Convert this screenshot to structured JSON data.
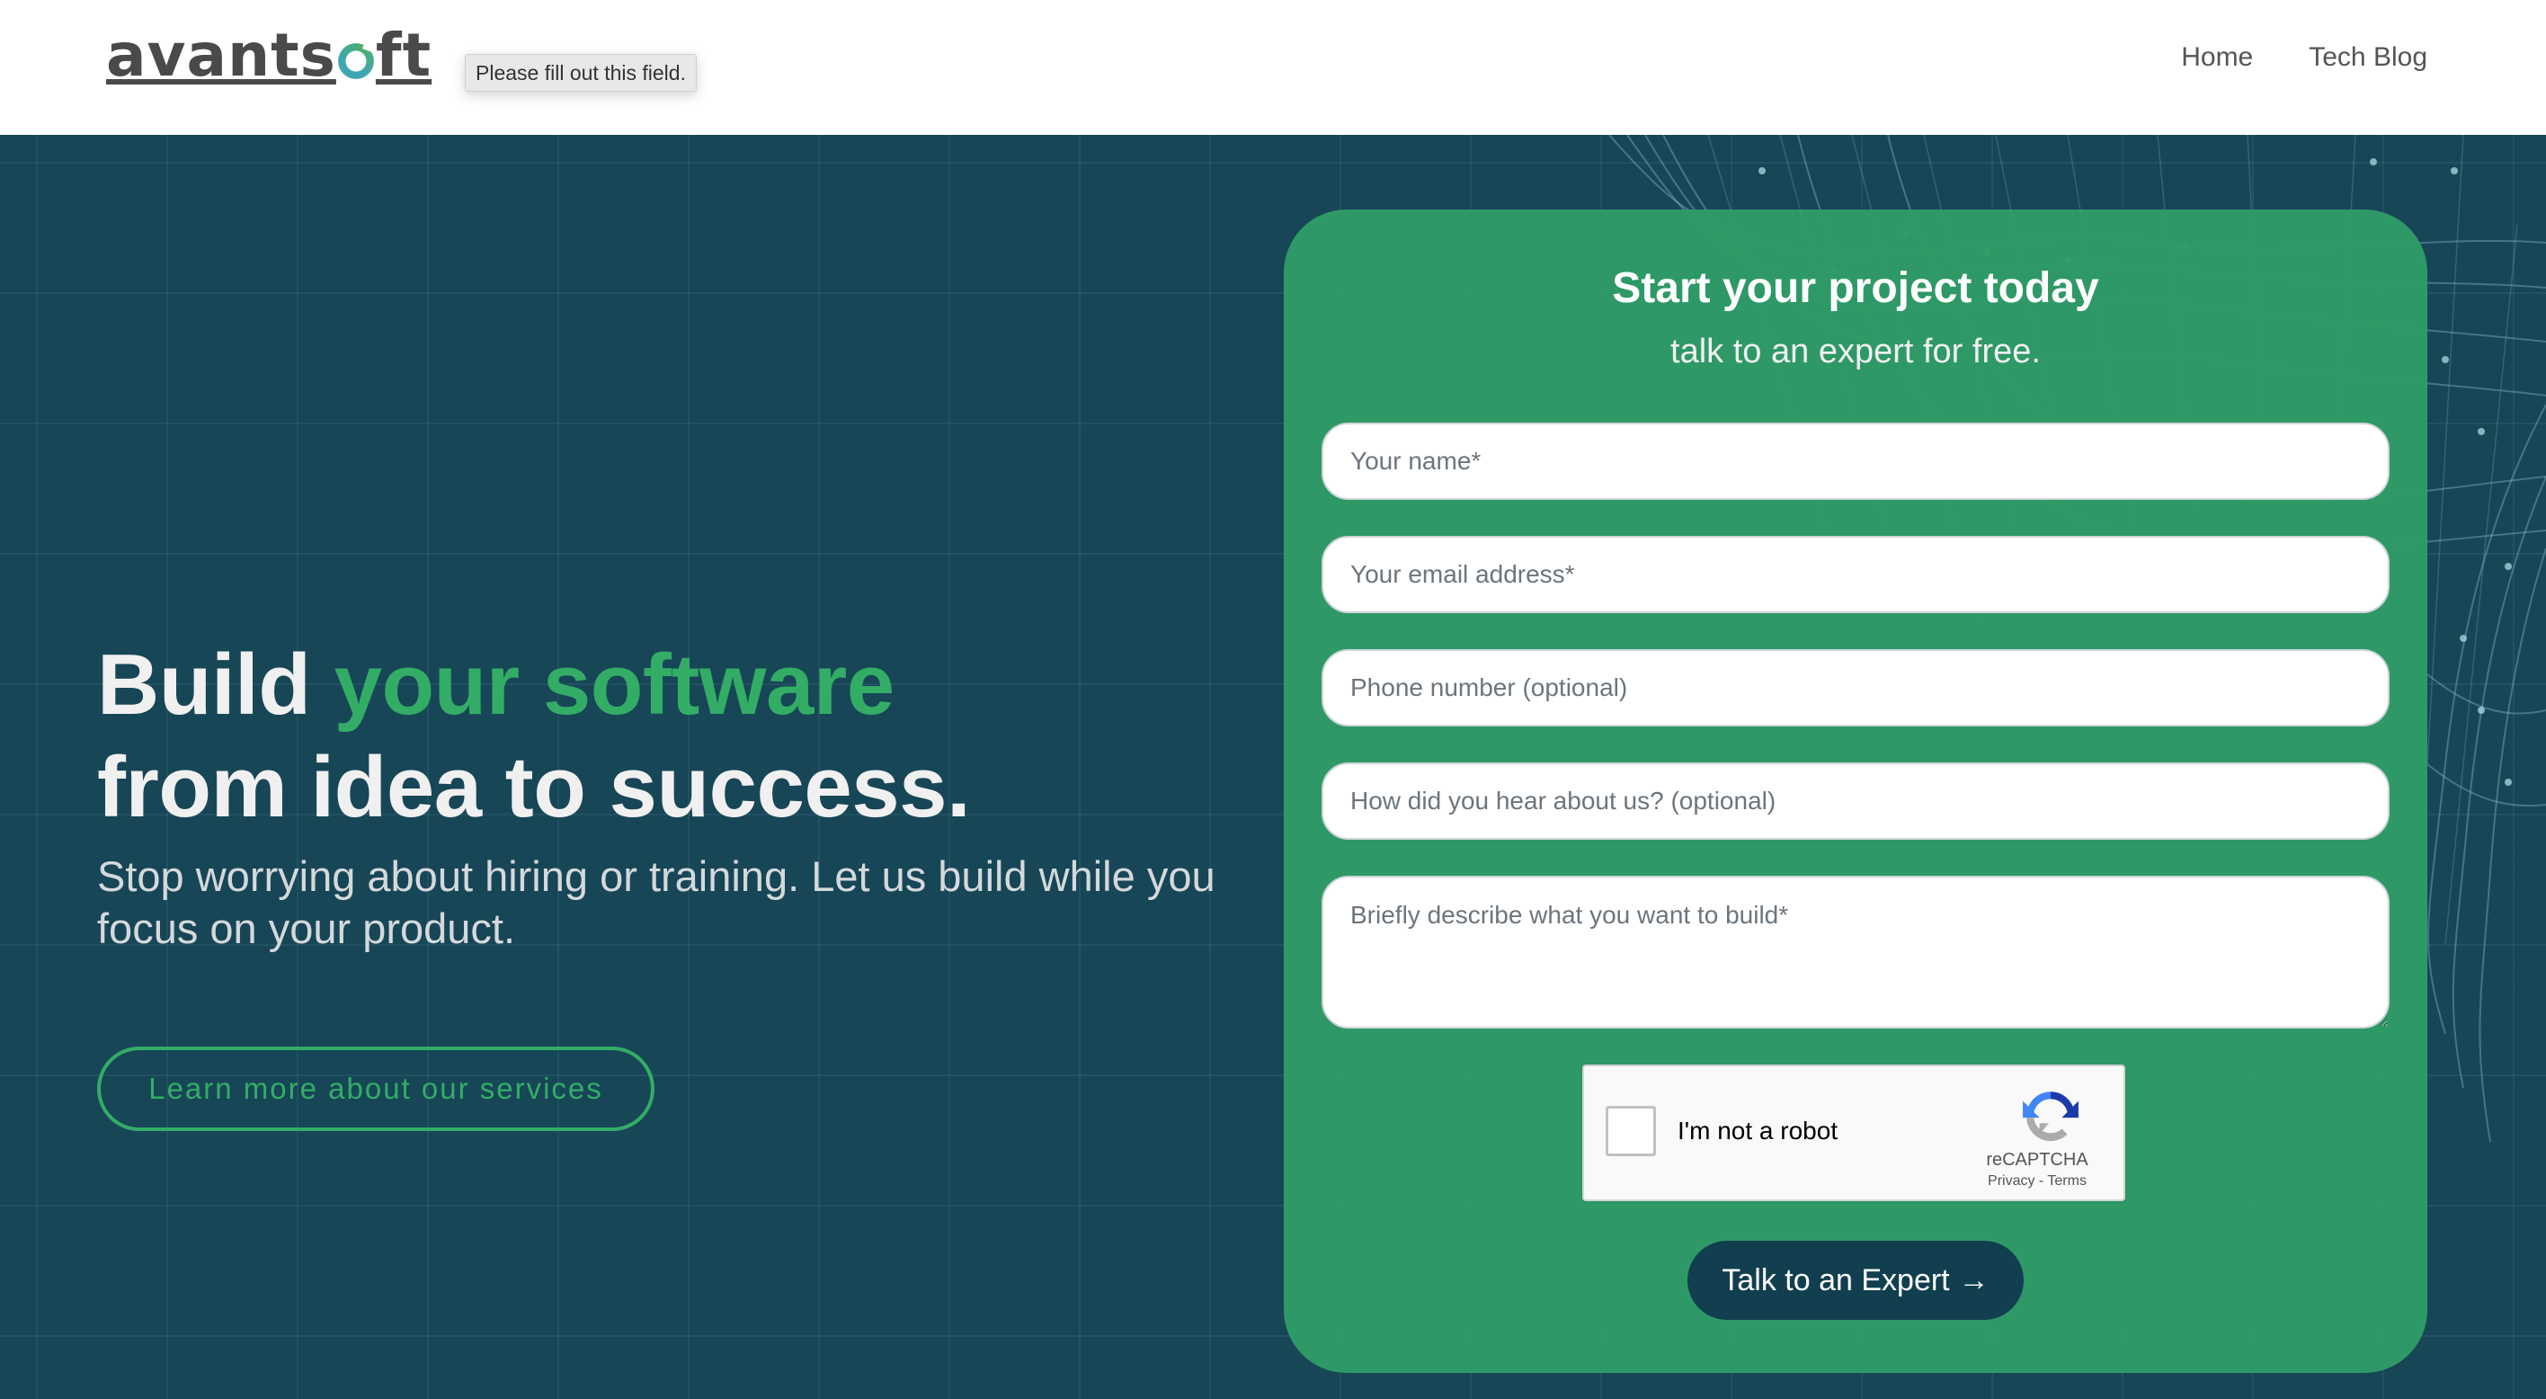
{
  "header": {
    "logo_text_before": "avants",
    "logo_text_after": "ft",
    "logo_alt": "avantsoft",
    "nav": [
      {
        "label": "Home"
      },
      {
        "label": "Tech Blog"
      }
    ]
  },
  "validation_tooltip": "Please fill out this field.",
  "hero": {
    "headline_line1_plain": "Build ",
    "headline_line1_accent": "your software",
    "headline_line2": "from idea to success.",
    "subheadline": "Stop worrying about hiring or training. Let us build while you focus on your product.",
    "cta_label": "Learn more about our services"
  },
  "form": {
    "title": "Start your project today",
    "subtitle": "talk to an expert for free.",
    "fields": {
      "name": {
        "placeholder": "Your name*",
        "value": ""
      },
      "email": {
        "placeholder": "Your email address*",
        "value": ""
      },
      "phone": {
        "placeholder": "Phone number (optional)",
        "value": ""
      },
      "referral": {
        "placeholder": "How did you hear about us? (optional)",
        "value": ""
      },
      "description": {
        "placeholder": "Briefly describe what you want to build*",
        "value": ""
      }
    },
    "captcha": {
      "label": "I'm not a robot",
      "checked": false,
      "brand": "reCAPTCHA",
      "privacy_label": "Privacy",
      "separator": " - ",
      "terms_label": "Terms",
      "icon": "recaptcha-logo"
    },
    "submit_label": "Talk to an Expert",
    "submit_icon": "→"
  },
  "colors": {
    "brand_green": "#33ad66",
    "card_green": "#309c66",
    "hero_bg": "#174657",
    "button_dark": "#113f4f",
    "nav_text": "#555555"
  }
}
